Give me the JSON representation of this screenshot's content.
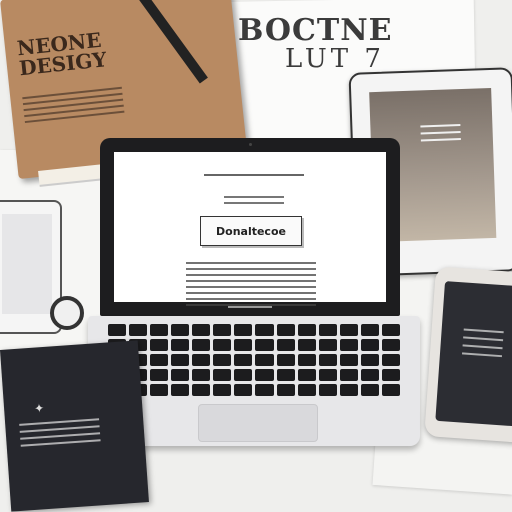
{
  "poster": {
    "line1": "BOCTNE",
    "line2": "LUT 7"
  },
  "book": {
    "title": "NEONE DESIGY"
  },
  "laptop": {
    "button_label": "Donaltecoe"
  }
}
